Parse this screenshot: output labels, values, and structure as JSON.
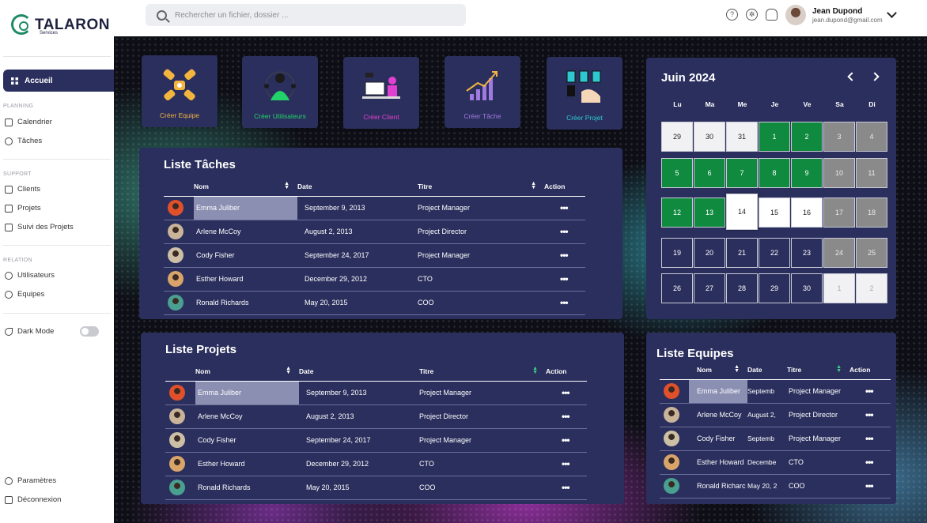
{
  "app": {
    "name": "TALARON",
    "subtitle": "Services"
  },
  "search": {
    "placeholder": "Rechercher un fichier, dossier ..."
  },
  "user": {
    "name": "Jean Dupond",
    "email": "jean.dupond@gmail.com"
  },
  "topbar_icons": [
    "help-icon",
    "settings-icon",
    "bell-icon"
  ],
  "sidebar": {
    "active": "Accueil",
    "sections": [
      {
        "title": "PLANNING",
        "items": [
          "Calendrier",
          "Tâches"
        ]
      },
      {
        "title": "SUPPORT",
        "items": [
          "Clients",
          "Projets",
          "Suivi des Projets"
        ]
      },
      {
        "title": "RELATION",
        "items": [
          "Utilisateurs",
          "Equipes"
        ]
      }
    ],
    "dark_mode": "Dark Mode",
    "dark_mode_on": false,
    "bottom": [
      "Paramètres",
      "Déconnexion"
    ]
  },
  "quick_actions": [
    {
      "label": "Créer Equipe",
      "color": "#f4b53f"
    },
    {
      "label": "Créer Utilisateurs",
      "color": "#21d36a"
    },
    {
      "label": "Créer Client",
      "color": "#e040d0"
    },
    {
      "label": "Créer Tâche",
      "color": "#a07ae0"
    },
    {
      "label": "Créer Projet",
      "color": "#2ec9d0"
    }
  ],
  "tasks": {
    "title": "Liste Tâches",
    "columns": [
      "Nom",
      "Date",
      "Titre",
      "Action"
    ],
    "rows": [
      {
        "name": "Emma Juliber",
        "date": "September 9, 2013",
        "title": "Project Manager",
        "action": "•••"
      },
      {
        "name": "Arlene McCoy",
        "date": "August 2, 2013",
        "title": "Project Director",
        "action": "•••"
      },
      {
        "name": "Cody Fisher",
        "date": "September 24, 2017",
        "title": "Project Manager",
        "action": "•••"
      },
      {
        "name": "Esther Howard",
        "date": "December 29, 2012",
        "title": "CTO",
        "action": "•••"
      },
      {
        "name": "Ronald Richards",
        "date": "May 20, 2015",
        "title": "COO",
        "action": "•••"
      }
    ]
  },
  "projects": {
    "title": "Liste Projets",
    "columns": [
      "Nom",
      "Date",
      "Titre",
      "Action"
    ],
    "rows": [
      {
        "name": "Emma Juliber",
        "date": "September 9, 2013",
        "title": "Project Manager",
        "action": "•••"
      },
      {
        "name": "Arlene McCoy",
        "date": "August 2, 2013",
        "title": "Project Director",
        "action": "•••"
      },
      {
        "name": "Cody Fisher",
        "date": "September 24, 2017",
        "title": "Project Manager",
        "action": "•••"
      },
      {
        "name": "Esther Howard",
        "date": "December 29, 2012",
        "title": "CTO",
        "action": "•••"
      },
      {
        "name": "Ronald Richards",
        "date": "May 20, 2015",
        "title": "COO",
        "action": "•••"
      }
    ]
  },
  "teams": {
    "title": "Liste Equipes",
    "columns": [
      "Nom",
      "Date",
      "Titre",
      "Action"
    ],
    "rows": [
      {
        "name": "Emma Juliber",
        "date": "Septemb",
        "title": "Project Manager",
        "action": "•••"
      },
      {
        "name": "Arlene McCoy",
        "date": "August 2,",
        "title": "Project Director",
        "action": "•••"
      },
      {
        "name": "Cody Fisher",
        "date": "Septemb",
        "title": "Project Manager",
        "action": "•••"
      },
      {
        "name": "Esther Howard",
        "date": "Decembe",
        "title": "CTO",
        "action": "•••"
      },
      {
        "name": "Ronald Richarc",
        "date": "May 20, 2",
        "title": "COO",
        "action": "•••"
      }
    ]
  },
  "calendar": {
    "month": "Juin 2024",
    "weekdays": [
      "Lu",
      "Ma",
      "Me",
      "Je",
      "Ve",
      "Sa",
      "Di"
    ],
    "weeks": [
      [
        "29",
        "30",
        "31",
        "1",
        "2",
        "3",
        "4"
      ],
      [
        "5",
        "6",
        "7",
        "8",
        "9",
        "10",
        "11"
      ],
      [
        "12",
        "13",
        "14",
        "15",
        "16",
        "17",
        "18"
      ],
      [
        "19",
        "20",
        "21",
        "22",
        "23",
        "24",
        "25"
      ],
      [
        "26",
        "27",
        "28",
        "29",
        "30",
        "1",
        "2"
      ]
    ],
    "states": [
      [
        "other",
        "other",
        "other",
        "busy",
        "busy",
        "weekend",
        "weekend"
      ],
      [
        "busy",
        "busy",
        "busy",
        "busy",
        "busy",
        "weekend",
        "weekend"
      ],
      [
        "busy",
        "busy",
        "today",
        "free",
        "free",
        "weekend",
        "weekend"
      ],
      [
        "normal",
        "normal",
        "normal",
        "normal",
        "normal",
        "weekend",
        "weekend"
      ],
      [
        "normal",
        "normal",
        "normal",
        "normal",
        "normal",
        "next",
        "next"
      ]
    ],
    "colors": {
      "busy": "#0f8a3f",
      "weekend": "#8a8a8a",
      "other": "#f1f1f3",
      "next": "#f1f1f3",
      "free": "#ffffff",
      "today": "#ffffff",
      "normal": "#2b2f5d"
    }
  },
  "avatar_colors": [
    "#e0502a",
    "#c9b49a",
    "#cdbfa6",
    "#d8a46a",
    "#4aa090"
  ]
}
